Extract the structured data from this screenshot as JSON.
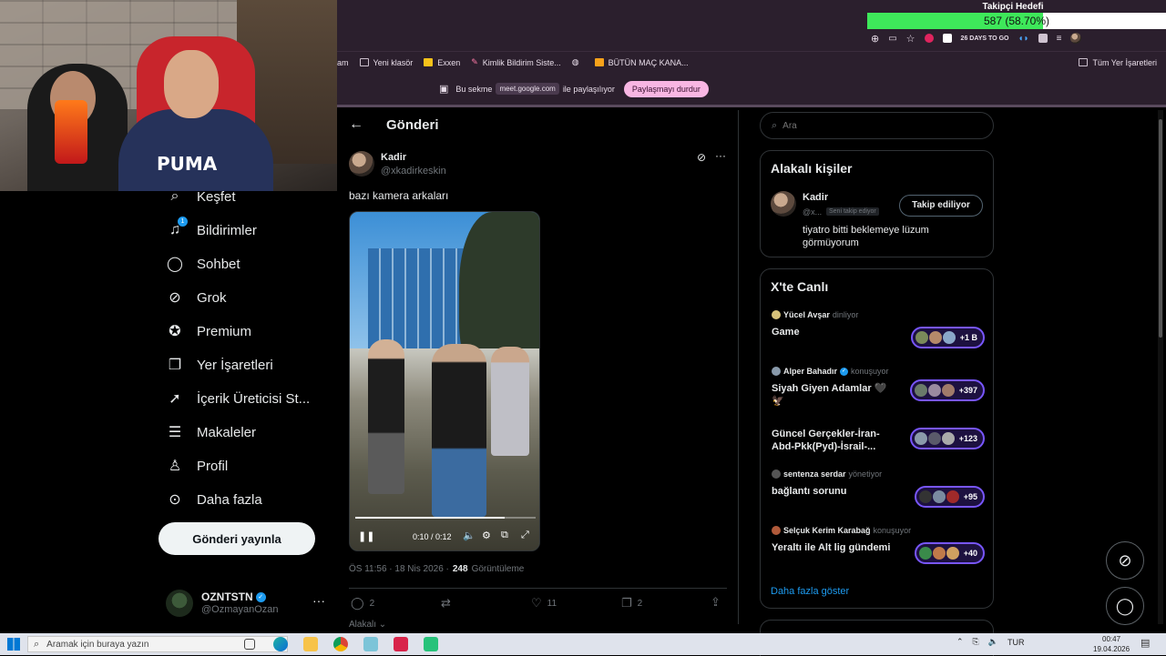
{
  "follow_goal": {
    "title": "Takipçi Hedefi",
    "progress_text": "587 (58.70%)",
    "progress": 0.587
  },
  "extension_text": "26 DAYS TO GO",
  "bookmarks": [
    {
      "label": "am"
    },
    {
      "label": "Yeni klasör"
    },
    {
      "label": "Exxen"
    },
    {
      "label": "Kimlik Bildirim Siste..."
    },
    {
      "label": ""
    },
    {
      "label": "BÜTÜN MAÇ KANA..."
    }
  ],
  "all_bookmarks": "Tüm Yer İşaretleri",
  "share_bar": {
    "prefix": "Bu sekme",
    "url": "meet.google.com",
    "suffix": "ile paylaşılıyor",
    "stop_label": "Paylaşmayı durdur"
  },
  "nav": {
    "items": [
      {
        "label": "Keşfet",
        "icon": "search-icon"
      },
      {
        "label": "Bildirimler",
        "icon": "bell-icon",
        "badge": "1"
      },
      {
        "label": "Sohbet",
        "icon": "chat-icon"
      },
      {
        "label": "Grok",
        "icon": "grok-icon"
      },
      {
        "label": "Premium",
        "icon": "verified-icon"
      },
      {
        "label": "Yer İşaretleri",
        "icon": "bookmark-icon"
      },
      {
        "label": "İçerik Üreticisi St...",
        "icon": "rocket-icon"
      },
      {
        "label": "Makaleler",
        "icon": "article-icon"
      },
      {
        "label": "Profil",
        "icon": "person-icon"
      },
      {
        "label": "Daha fazla",
        "icon": "more-circle-icon"
      }
    ],
    "post_button": "Gönderi yayınla",
    "account": {
      "name": "OZNTSTN",
      "handle": "@OzmayanOzan"
    }
  },
  "post": {
    "header_title": "Gönderi",
    "author_name": "Kadir",
    "author_handle": "@xkadirkeskin",
    "text": "bazı kamera arkaları",
    "video_time": "0:10 / 0:12",
    "video_progress": 0.83,
    "timestamp": "ÖS 11:56 · 18 Nis 2026 ·",
    "views_count": "248",
    "views_label": "Görüntüleme",
    "replies": "2",
    "reposts": "",
    "likes": "11",
    "bookmarks": "2",
    "relevant_label": "Alakalı"
  },
  "sidebar": {
    "search_placeholder": "Ara",
    "relevant_people": {
      "title": "Alakalı kişiler",
      "name": "Kadir",
      "handle": "@x...",
      "follows_you": "Seni takip ediyor",
      "follow_button": "Takip ediliyor",
      "bio": "tiyatro bitti beklemeye lüzum görmüyorum"
    },
    "live": {
      "title": "X'te Canlı",
      "items": [
        {
          "host": "Yücel Avşar",
          "role": "dinliyor",
          "title": "Game",
          "count": "+1 B"
        },
        {
          "host": "Alper Bahadır",
          "role": "konuşuyor",
          "title": "Siyah Giyen Adamlar 🖤 🦅",
          "count": "+397"
        },
        {
          "host": "",
          "role": "",
          "title": "Güncel Gerçekler-İran-Abd-Pkk(Pyd)-İsrail-...",
          "count": "+123"
        },
        {
          "host": "sentenza serdar",
          "role": "yönetiyor",
          "title": "bağlantı sorunu",
          "count": "+95"
        },
        {
          "host": "Selçuk Kerim Karabağ",
          "role": "konuşuyor",
          "title": "Yeraltı ile Alt lig gündemi",
          "count": "+40"
        }
      ],
      "show_more": "Daha fazla göster"
    }
  },
  "taskbar": {
    "search_placeholder": "Aramak için buraya yazın",
    "lang": "TUR",
    "time": "00:47",
    "date": "19.04.2026"
  },
  "colors": {
    "accent": "#1d9bf0",
    "live_purple": "#7856ff",
    "goal_green": "#3ee85a"
  }
}
